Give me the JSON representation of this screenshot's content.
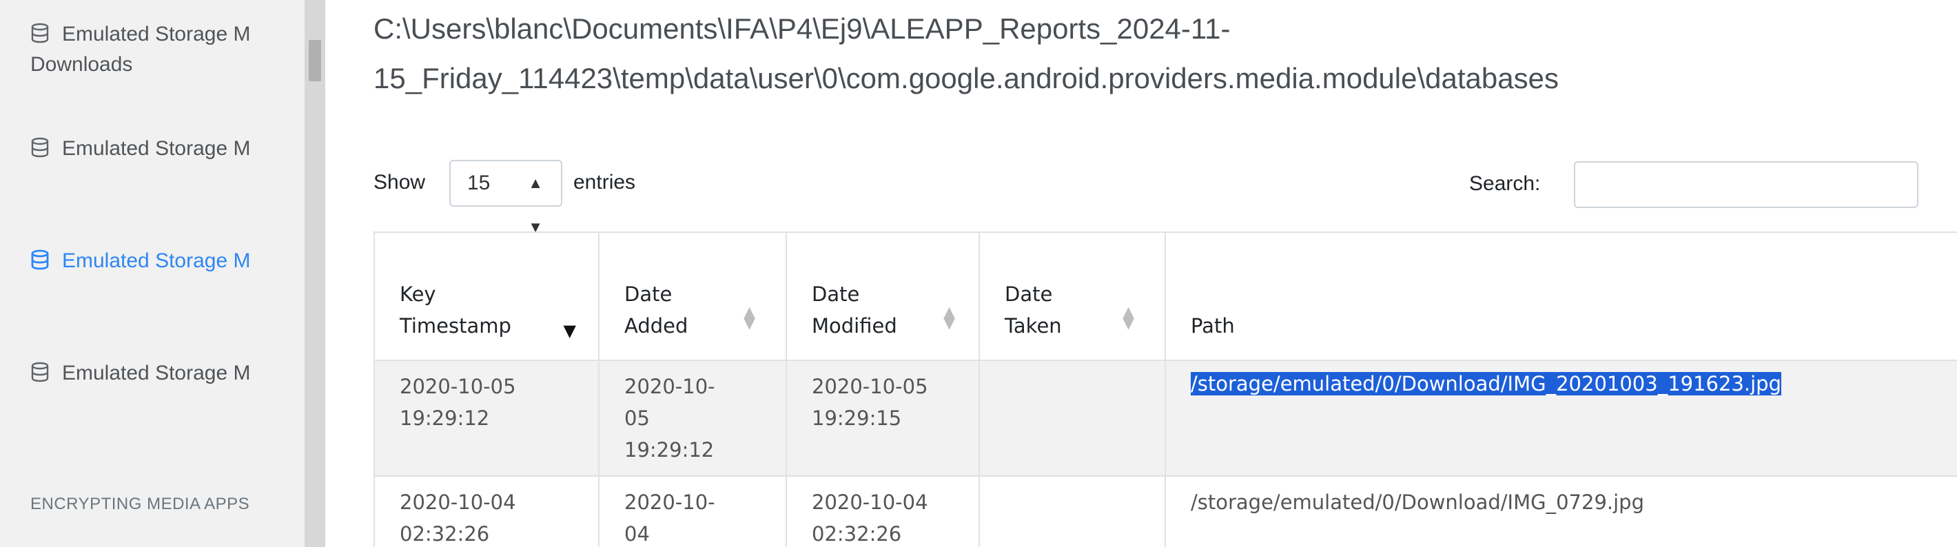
{
  "sidebar": {
    "items": [
      {
        "label": "Emulated Storage M",
        "sub": "Downloads",
        "active": false
      },
      {
        "label": "Emulated Storage M",
        "active": false
      },
      {
        "label": "Emulated Storage M",
        "active": true
      },
      {
        "label": "Emulated Storage M",
        "active": false
      }
    ],
    "section_heading": "ENCRYPTING MEDIA APPS",
    "icon": "database-icon",
    "active_color": "#2e86f5"
  },
  "report": {
    "path_line1": "C:\\Users\\blanc\\Documents\\IFA\\P4\\Ej9\\ALEAPP_Reports_2024-11-",
    "path_line2": "15_Friday_114423\\temp\\data\\user\\0\\com.google.android.providers.media.module\\databases"
  },
  "controls": {
    "show_label": "Show",
    "page_length": "15",
    "entries_label": "entries",
    "search_label": "Search:",
    "search_value": ""
  },
  "table": {
    "columns": [
      {
        "line1": "Key",
        "line2": "Timestamp",
        "sort": "desc"
      },
      {
        "line1": "Date",
        "line2": "Added",
        "sort": "none"
      },
      {
        "line1": "Date",
        "line2": "Modified",
        "sort": "none"
      },
      {
        "line1": "Date",
        "line2": "Taken",
        "sort": "none"
      },
      {
        "line1": "",
        "line2": "Path",
        "sort": "none"
      }
    ],
    "rows": [
      {
        "key_ts": [
          "2020-10-05",
          "19:29:12"
        ],
        "added": [
          "2020-10-",
          "05",
          "19:29:12"
        ],
        "modified": [
          "2020-10-05",
          "19:29:15"
        ],
        "taken": "",
        "path": "/storage/emulated/0/Download/IMG_20201003_191623.jpg",
        "path_selected": true
      },
      {
        "key_ts": [
          "2020-10-04",
          "02:32:26"
        ],
        "added": [
          "2020-10-",
          "04"
        ],
        "modified": [
          "2020-10-04",
          "02:32:26"
        ],
        "taken": "",
        "path": "/storage/emulated/0/Download/IMG_0729.jpg",
        "path_selected": false
      }
    ]
  }
}
